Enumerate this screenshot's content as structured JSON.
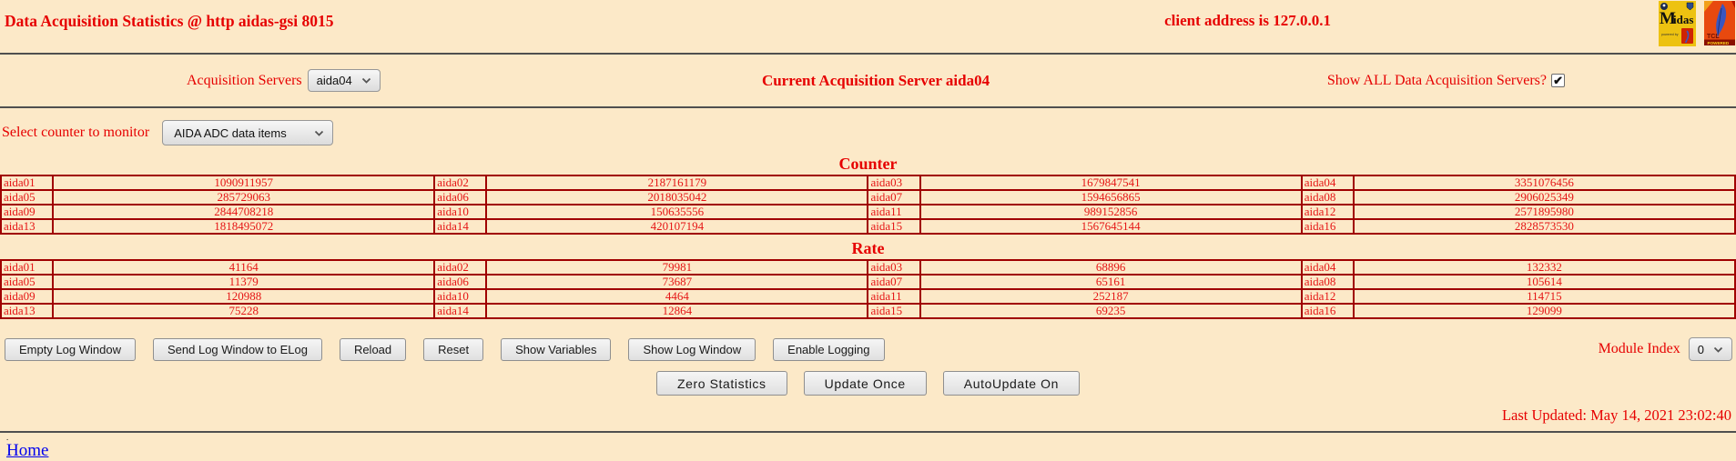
{
  "colors": {
    "background": "#fce9c8",
    "accent_red": "#e60000",
    "table_border": "#a00000",
    "table_text": "#e51515",
    "link_blue": "#0000ee"
  },
  "icons": {
    "check": "✔"
  },
  "header": {
    "title": "Data Acquisition Statistics @ http aidas-gsi 8015",
    "client_address": "client address is 127.0.0.1",
    "midas_logo_text": "Midas",
    "midas_logo_subtext": "powered by",
    "tcl_logo_text": "TCL",
    "tcl_logo_subtext": "POWERED"
  },
  "server_bar": {
    "label": "Acquisition Servers",
    "selected_server": "aida04",
    "current_server_text": "Current Acquisition Server aida04",
    "show_all_label": "Show ALL Data Acquisition Servers?",
    "show_all_checked": true
  },
  "counter_select": {
    "label": "Select counter to monitor",
    "selected": "AIDA ADC data items"
  },
  "counter_table": {
    "heading": "Counter",
    "rows": [
      [
        "aida01",
        "1090911957",
        "aida02",
        "2187161179",
        "aida03",
        "1679847541",
        "aida04",
        "3351076456"
      ],
      [
        "aida05",
        "285729063",
        "aida06",
        "2018035042",
        "aida07",
        "1594656865",
        "aida08",
        "2906025349"
      ],
      [
        "aida09",
        "2844708218",
        "aida10",
        "150635556",
        "aida11",
        "989152856",
        "aida12",
        "2571895980"
      ],
      [
        "aida13",
        "1818495072",
        "aida14",
        "420107194",
        "aida15",
        "1567645144",
        "aida16",
        "2828573530"
      ]
    ]
  },
  "rate_table": {
    "heading": "Rate",
    "rows": [
      [
        "aida01",
        "41164",
        "aida02",
        "79981",
        "aida03",
        "68896",
        "aida04",
        "132332"
      ],
      [
        "aida05",
        "11379",
        "aida06",
        "73687",
        "aida07",
        "65161",
        "aida08",
        "105614"
      ],
      [
        "aida09",
        "120988",
        "aida10",
        "4464",
        "aida11",
        "252187",
        "aida12",
        "114715"
      ],
      [
        "aida13",
        "75228",
        "aida14",
        "12864",
        "aida15",
        "69235",
        "aida16",
        "129099"
      ]
    ]
  },
  "toolbar": {
    "buttons": [
      "Empty Log Window",
      "Send Log Window to ELog",
      "Reload",
      "Reset",
      "Show Variables",
      "Show Log Window",
      "Enable Logging"
    ],
    "module_index_label": "Module Index",
    "module_index_value": "0"
  },
  "update_bar": {
    "buttons": [
      "Zero Statistics",
      "Update Once",
      "AutoUpdate On"
    ]
  },
  "footer": {
    "last_updated": "Last Updated: May 14, 2021 23:02:40",
    "dot": ".",
    "home_label": "Home"
  }
}
